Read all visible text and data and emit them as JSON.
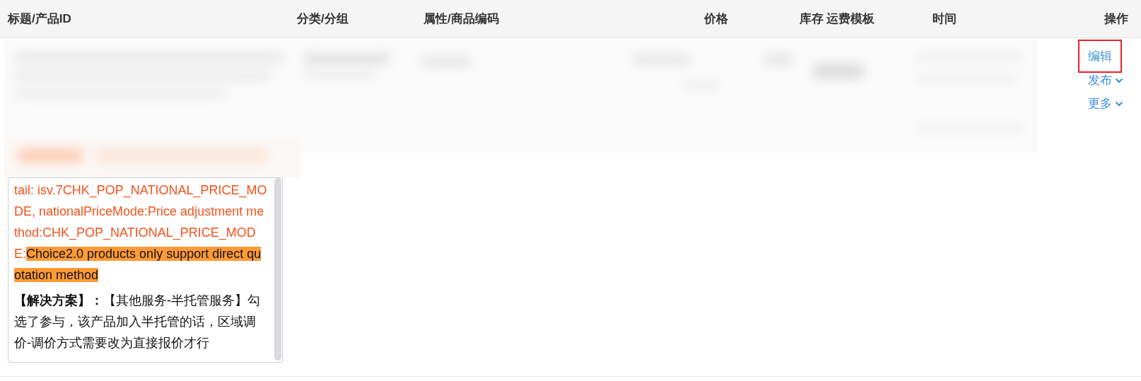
{
  "table": {
    "columns": [
      {
        "label": "标题/产品ID"
      },
      {
        "label": "分类/分组"
      },
      {
        "label": "属性/商品编码"
      },
      {
        "label": "价格"
      },
      {
        "label": "库存"
      },
      {
        "label": "运费模板"
      },
      {
        "label": "时间"
      },
      {
        "label": "操作"
      }
    ],
    "row": {
      "actions": [
        {
          "label": "编辑",
          "dropdown": false,
          "outlined": true
        },
        {
          "label": "发布",
          "dropdown": true,
          "outlined": false
        },
        {
          "label": "更多",
          "dropdown": true,
          "outlined": false
        }
      ]
    }
  },
  "error_popup": {
    "message": [
      {
        "text": "tail: isv.7CHK_POP_NATIONAL_PRICE_MODE, nationalPriceMode:Price adjustment method:CHK_POP_NATIONAL_PRICE_MODE:",
        "highlighted": false
      },
      {
        "text": "Choice2.0 products only support direct quotation method",
        "highlighted": true
      }
    ],
    "solution_label": "【解决方案】：",
    "solution_text": "【其他服务-半托管服务】勾选了参与，该产品加入半托管的话，区域调价-调价方式需要改为直接报价才行"
  }
}
